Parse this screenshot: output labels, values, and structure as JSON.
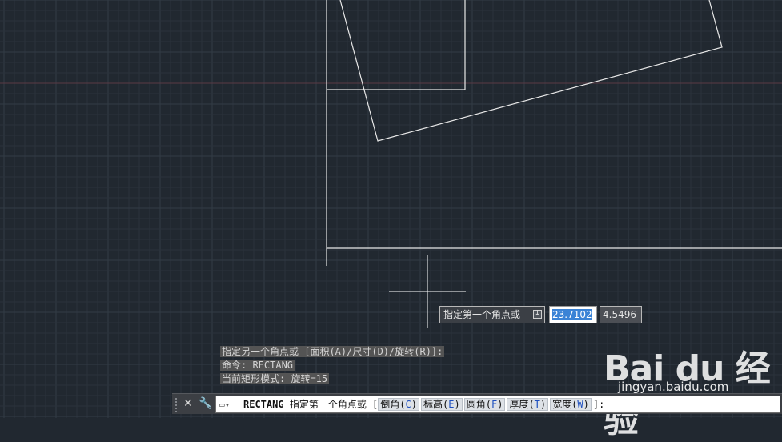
{
  "colors": {
    "background": "#212830",
    "grid_minor": "#2a323b",
    "grid_major": "#333c46",
    "axis_red": "#5a3a44",
    "geometry": "#e8e8e8",
    "crosshair": "#ffffff",
    "selection": "#3a83d6"
  },
  "history": [
    "指定另一个角点或 [面积(A)/尺寸(D)/旋转(R)]:",
    "命令:  RECTANG",
    "当前矩形模式:  旋转=15"
  ],
  "dynamic_input": {
    "prompt": "指定第一个角点或",
    "x_value": "23.7102",
    "y_value": "4.5496"
  },
  "command_line": {
    "command": "RECTANG",
    "prompt": "指定第一个角点或 [",
    "options": [
      {
        "label": "倒角",
        "key": "C"
      },
      {
        "label": "标高",
        "key": "E"
      },
      {
        "label": "圆角",
        "key": "F"
      },
      {
        "label": "厚度",
        "key": "T"
      },
      {
        "label": "宽度",
        "key": "W"
      }
    ],
    "suffix": "]:"
  },
  "icons": {
    "close": "✕",
    "wrench": "🔧",
    "prompt": "▭▾"
  },
  "watermark": {
    "logo": "Bai du 经验",
    "url": "jingyan.baidu.com"
  }
}
